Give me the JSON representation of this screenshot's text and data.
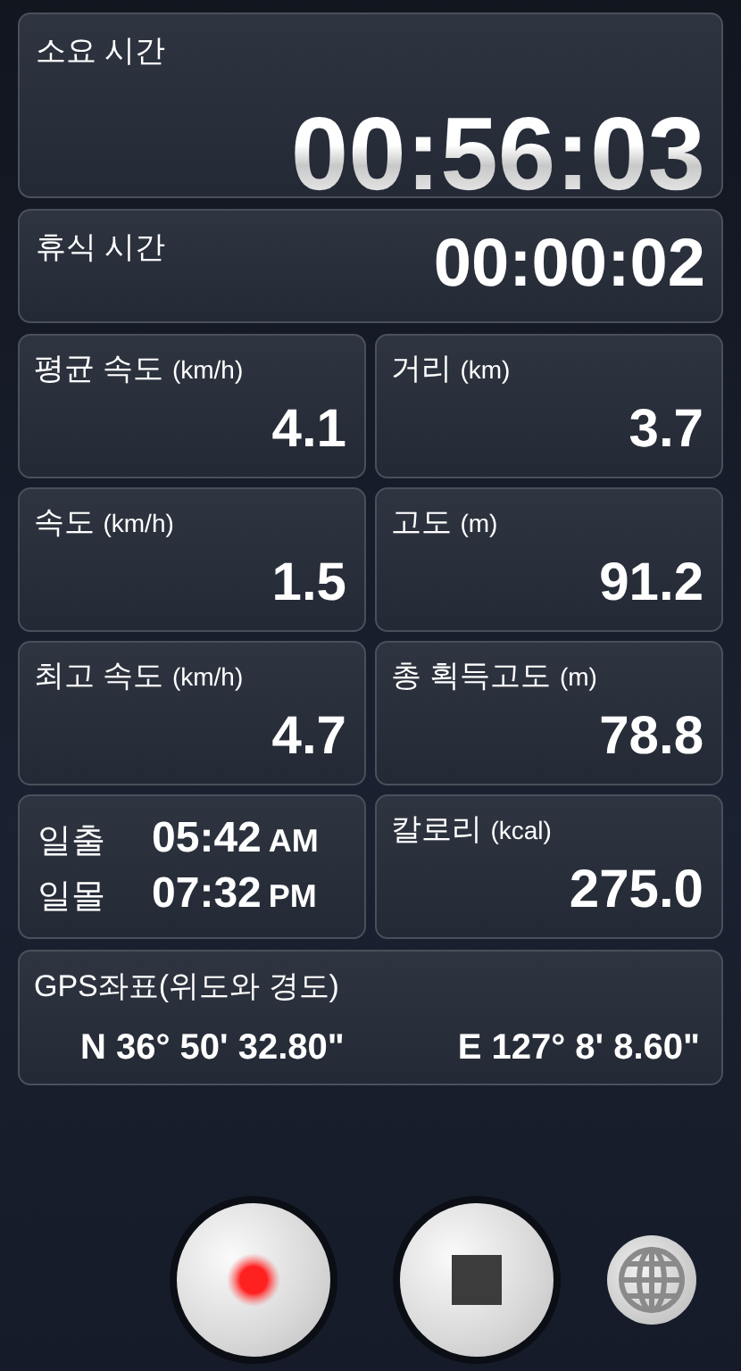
{
  "timers": [
    {
      "label": "소요 시간",
      "value": "00:56:03",
      "kind": "large"
    },
    {
      "label": "휴식 시간",
      "value": "00:00:02",
      "kind": "medium"
    }
  ],
  "cells": [
    {
      "kind": "stat",
      "label": "평균 속도",
      "unit": "(km/h)",
      "value": "4.1"
    },
    {
      "kind": "stat",
      "label": "거리",
      "unit": "(km)",
      "value": "3.7"
    },
    {
      "kind": "stat",
      "label": "속도",
      "unit": "(km/h)",
      "value": "1.5"
    },
    {
      "kind": "stat",
      "label": "고도",
      "unit": "(m)",
      "value": "91.2"
    },
    {
      "kind": "stat",
      "label": "최고 속도",
      "unit": "(km/h)",
      "value": "4.7"
    },
    {
      "kind": "stat",
      "label": "총 획득고도",
      "unit": "(m)",
      "value": "78.8"
    },
    {
      "kind": "sun",
      "rows": [
        {
          "label": "일출",
          "time": "05:42",
          "period": "AM"
        },
        {
          "label": "일몰",
          "time": "07:32",
          "period": "PM"
        }
      ]
    },
    {
      "kind": "stat",
      "label": "칼로리",
      "unit": "(kcal)",
      "value": "275.0"
    }
  ],
  "gps": {
    "label": "GPS좌표(위도와 경도)",
    "latitude": "N 36° 50' 32.80\"",
    "longitude": "E 127° 8' 8.60\""
  },
  "controls": [
    {
      "kind": "record"
    },
    {
      "kind": "stop"
    },
    {
      "kind": "globe"
    }
  ]
}
